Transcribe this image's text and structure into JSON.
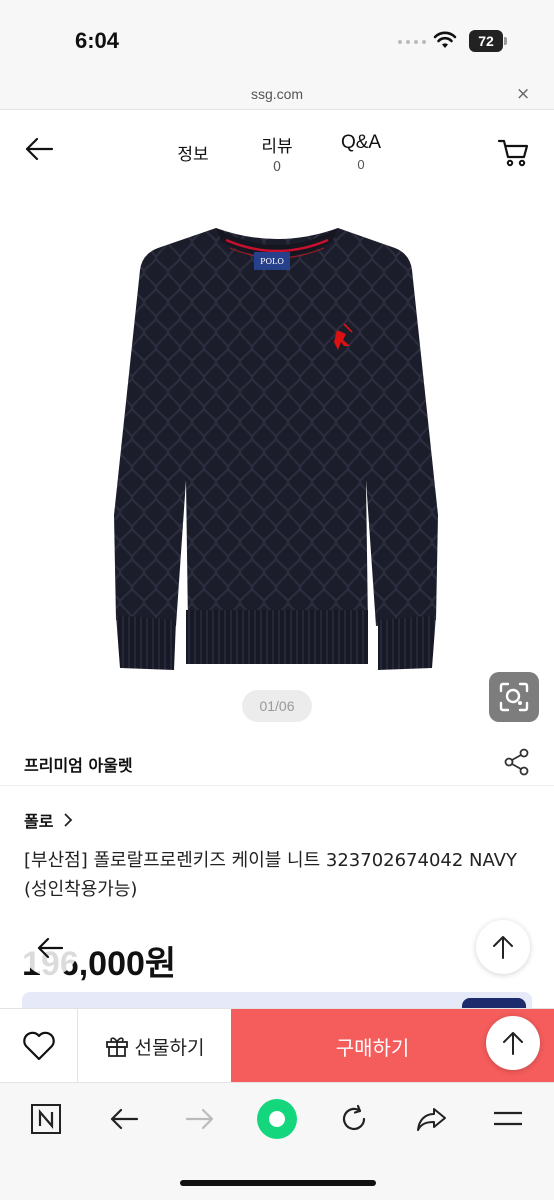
{
  "status_bar": {
    "time": "6:04",
    "battery": "72"
  },
  "url_bar": {
    "domain": "ssg.com",
    "close_glyph": "×"
  },
  "header": {
    "tabs": [
      {
        "label": "정보",
        "count": ""
      },
      {
        "label": "리뷰",
        "count": "0"
      },
      {
        "label": "Q&A",
        "count": "0"
      }
    ]
  },
  "product": {
    "image_counter": "01/06",
    "store_name": "프리미엄 아울렛",
    "brand": "폴로",
    "title": "[부산점] 폴로랄프로렌키즈 케이블 니트 323702674042 NAVY (성인착용가능)",
    "price": "196,000원",
    "logo_text": "POLO"
  },
  "actions": {
    "gift_label": "선물하기",
    "buy_label": "구매하기"
  },
  "colors": {
    "buy_button": "#f55c5c",
    "sweater": "#1c1d2b",
    "coupon_strip": "#e6e9f8",
    "browser_green": "#14d67c"
  },
  "icons": {
    "back": "back-arrow-icon",
    "cart": "cart-icon",
    "share": "share-icon",
    "lens": "lens-search-icon",
    "heart": "heart-icon",
    "gift": "gift-icon",
    "scroll_top": "arrow-up-icon"
  }
}
